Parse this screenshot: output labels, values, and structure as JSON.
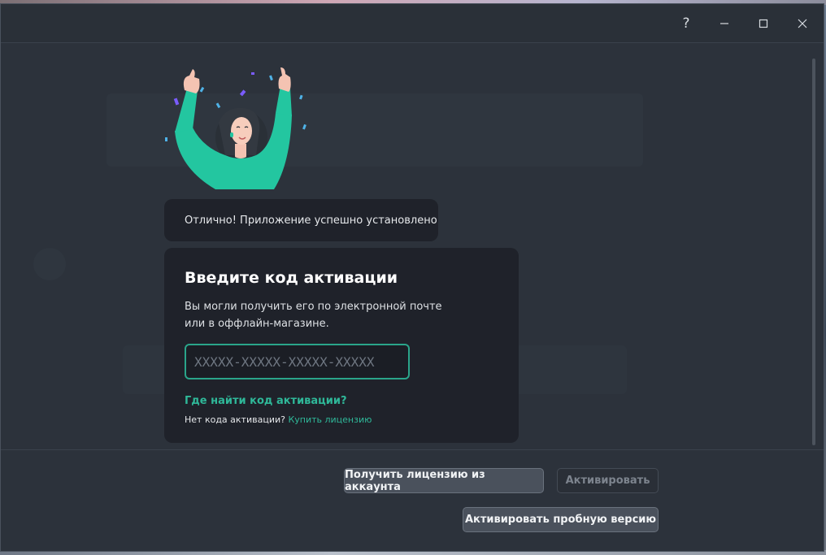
{
  "window": {
    "controls": {
      "help_label": "?",
      "help_icon": "question-icon",
      "minimize_icon": "minimize-icon",
      "maximize_icon": "maximize-icon",
      "close_icon": "close-icon"
    }
  },
  "colors": {
    "accent": "#2fb899",
    "panel": "#1f222a",
    "window_bg": "#2c323b"
  },
  "illustration": {
    "icon": "celebrating-woman-illustration"
  },
  "toast": {
    "message": "Отлично! Приложение успешно установлено"
  },
  "activation": {
    "title": "Введите код активации",
    "description": "Вы могли получить его по электронной почте или в оффлайн-магазине.",
    "code_placeholder": "XXXXX-XXXXX-XXXXX-XXXXX",
    "code_value": "",
    "find_code_link": "Где найти код активации?",
    "no_code_text": "Нет кода активации?",
    "buy_license_link": "Купить лицензию"
  },
  "footer": {
    "get_license_button": "Получить лицензию из аккаунта",
    "activate_button": "Активировать",
    "trial_button": "Активировать пробную версию"
  }
}
